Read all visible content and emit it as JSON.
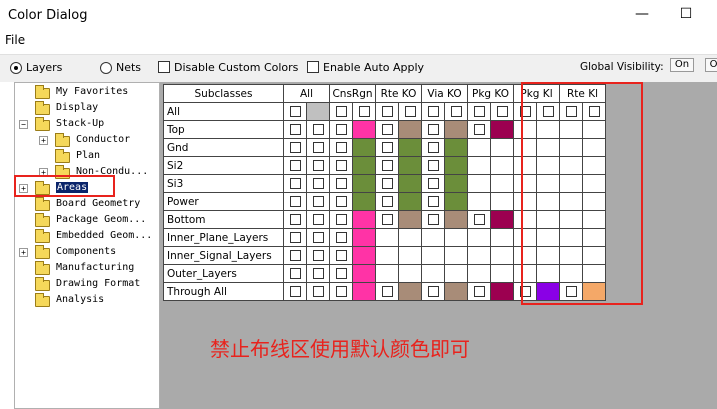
{
  "window": {
    "title": "Color Dialog",
    "minimize_symbol": "—",
    "maximize_symbol": "☐"
  },
  "menu": {
    "file": "File"
  },
  "toolbar": {
    "layers_label": "Layers",
    "nets_label": "Nets",
    "disable_custom_colors_label": "Disable Custom Colors",
    "enable_auto_apply_label": "Enable Auto Apply",
    "global_visibility_label": "Global Visibility:",
    "on_label": "On",
    "off_label": "Off",
    "selected_mode": "Layers"
  },
  "tree": {
    "items": [
      {
        "label": "My Favorites",
        "expander": ""
      },
      {
        "label": "Display",
        "expander": ""
      },
      {
        "label": "Stack-Up",
        "expander": "−"
      },
      {
        "label": "Conductor",
        "expander": "+"
      },
      {
        "label": "Plan",
        "expander": ""
      },
      {
        "label": "Non-Condu...",
        "expander": "+"
      },
      {
        "label": "Areas",
        "expander": "+",
        "selected": true
      },
      {
        "label": "Board Geometry",
        "expander": ""
      },
      {
        "label": "Package Geom...",
        "expander": ""
      },
      {
        "label": "Embedded Geom...",
        "expander": ""
      },
      {
        "label": "Components",
        "expander": "+"
      },
      {
        "label": "Manufacturing",
        "expander": ""
      },
      {
        "label": "Drawing Format",
        "expander": ""
      },
      {
        "label": "Analysis",
        "expander": ""
      }
    ]
  },
  "grid": {
    "subclasses_header": "Subclasses",
    "columns": [
      "All",
      "CnsRgn",
      "Rte KO",
      "Via KO",
      "Pkg KO",
      "Pkg Kl",
      "Rte Kl"
    ],
    "rows": [
      {
        "label": "All",
        "cells": [
          "cc:#c0c0c0",
          "cc",
          "cc",
          "cc",
          "cc",
          "cc",
          "cc"
        ]
      },
      {
        "label": "Top",
        "cells": [
          "cc",
          "cc:#ff33a6",
          "cc:#a88c78",
          "cc:#a88c78",
          "cc:#9c0050",
          "",
          ""
        ]
      },
      {
        "label": "Gnd",
        "cells": [
          "cc",
          "cc:#6b8e3a",
          "cc:#6b8e3a",
          "cc:#6b8e3a",
          "",
          "",
          ""
        ]
      },
      {
        "label": "Si2",
        "cells": [
          "cc",
          "cc:#6b8e3a",
          "cc:#6b8e3a",
          "cc:#6b8e3a",
          "",
          "",
          ""
        ]
      },
      {
        "label": "Si3",
        "cells": [
          "cc",
          "cc:#6b8e3a",
          "cc:#6b8e3a",
          "cc:#6b8e3a",
          "",
          "",
          ""
        ]
      },
      {
        "label": "Power",
        "cells": [
          "cc",
          "cc:#6b8e3a",
          "cc:#6b8e3a",
          "cc:#6b8e3a",
          "",
          "",
          ""
        ]
      },
      {
        "label": "Bottom",
        "cells": [
          "cc",
          "cc:#ff33a6",
          "cc:#a88c78",
          "cc:#a88c78",
          "cc:#9c0050",
          "",
          ""
        ]
      },
      {
        "label": "Inner_Plane_Layers",
        "cells": [
          "cc",
          "cc:#ff33a6",
          "",
          "",
          "",
          "",
          ""
        ]
      },
      {
        "label": "Inner_Signal_Layers",
        "cells": [
          "cc",
          "cc:#ff33a6",
          "",
          "",
          "",
          "",
          ""
        ]
      },
      {
        "label": "Outer_Layers",
        "cells": [
          "cc",
          "cc:#ff33a6",
          "",
          "",
          "",
          "",
          ""
        ]
      },
      {
        "label": "Through All",
        "cells": [
          "cc",
          "cc:#ff33a6",
          "cc:#a88c78",
          "cc:#a88c78",
          "cc:#9c0050",
          "cc:#8a00e6",
          "cc:#f4a868"
        ]
      }
    ]
  },
  "annotation": {
    "text": "禁止布线区使用默认颜色即可",
    "color": "#e8231d"
  }
}
